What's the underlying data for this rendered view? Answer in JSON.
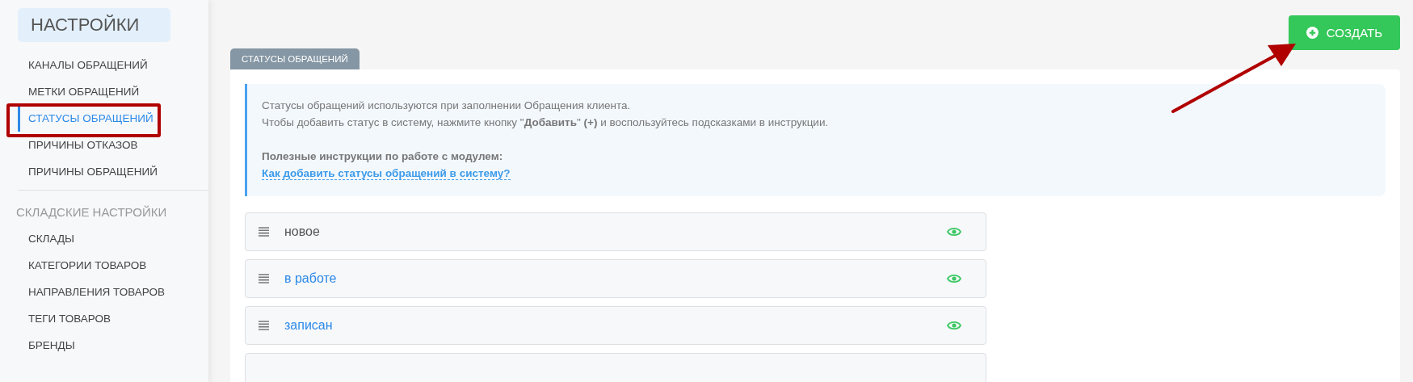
{
  "sidebar": {
    "title": "НАСТРОЙКИ",
    "sections": [
      {
        "items": [
          {
            "label": "КАНАЛЫ ОБРАЩЕНИЙ",
            "selected": false
          },
          {
            "label": "МЕТКИ ОБРАЩЕНИЙ",
            "selected": false
          },
          {
            "label": "СТАТУСЫ ОБРАЩЕНИЙ",
            "selected": true
          },
          {
            "label": "ПРИЧИНЫ ОТКАЗОВ",
            "selected": false
          },
          {
            "label": "ПРИЧИНЫ ОБРАЩЕНИЙ",
            "selected": false
          }
        ]
      },
      {
        "title": "СКЛАДСКИЕ НАСТРОЙКИ",
        "items": [
          {
            "label": "СКЛАДЫ",
            "selected": false
          },
          {
            "label": "КАТЕГОРИИ ТОВАРОВ",
            "selected": false
          },
          {
            "label": "НАПРАВЛЕНИЯ ТОВАРОВ",
            "selected": false
          },
          {
            "label": "ТЕГИ ТОВАРОВ",
            "selected": false
          },
          {
            "label": "БРЕНДЫ",
            "selected": false
          }
        ]
      }
    ]
  },
  "create_button": {
    "label": "СОЗДАТЬ"
  },
  "tabs": [
    {
      "label": "СТАТУСЫ ОБРАЩЕНИЙ",
      "selected": true
    }
  ],
  "info": {
    "lines": [
      "Статусы обращений используются при заполнении Обращения клиента.",
      "Чтобы добавить статус в систему, нажмите кнопку \"**Добавить**\" **(+)** и воспользуйтесь подсказками в инструкции."
    ],
    "help_title": "Полезные инструкции по работе с модулем:",
    "help_link": "Как добавить статусы обращений в систему?"
  },
  "statuses": [
    {
      "name": "новое",
      "linked": false,
      "visible": true
    },
    {
      "name": "в работе",
      "linked": true,
      "visible": true
    },
    {
      "name": "записан",
      "linked": true,
      "visible": true
    }
  ]
}
